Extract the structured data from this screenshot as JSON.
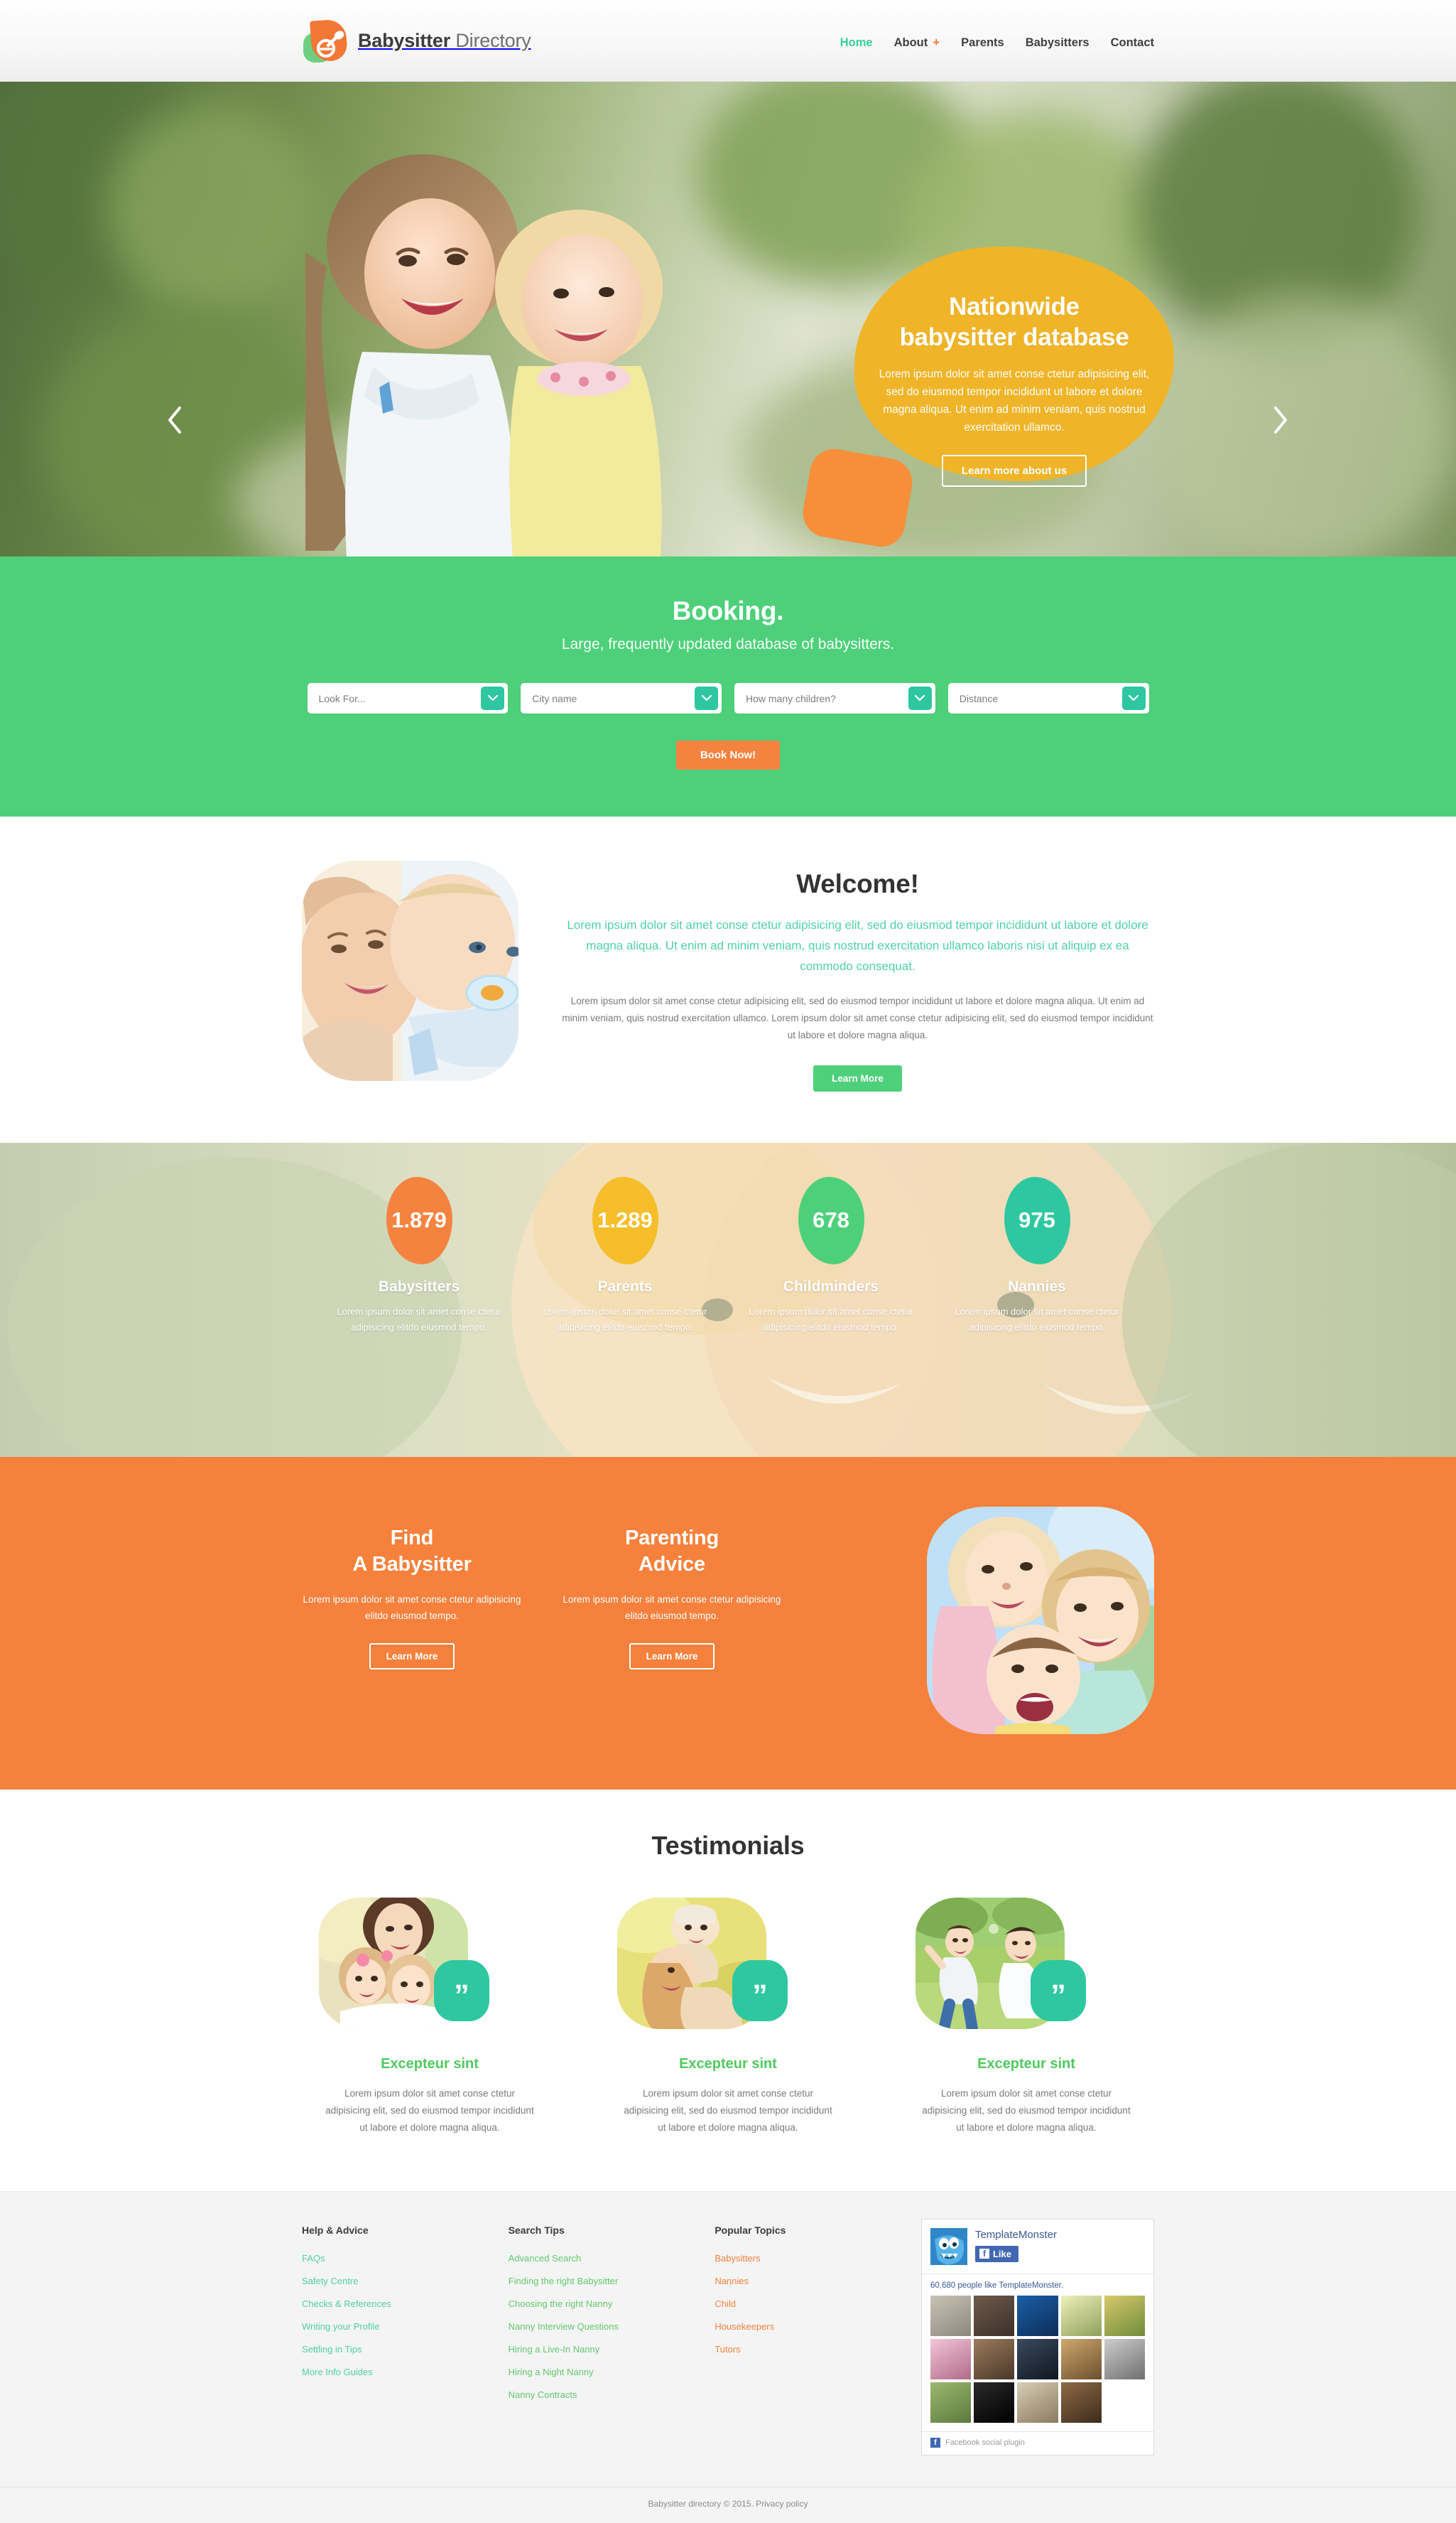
{
  "header": {
    "brand_bold": "Babysitter",
    "brand_light": " Directory",
    "logo_icon": "pacifier-logo-icon",
    "nav": [
      {
        "label": "Home",
        "active": true,
        "plus": ""
      },
      {
        "label": "About",
        "active": false,
        "plus": "+"
      },
      {
        "label": "Parents",
        "active": false,
        "plus": ""
      },
      {
        "label": "Babysitters",
        "active": false,
        "plus": ""
      },
      {
        "label": "Contact",
        "active": false,
        "plus": ""
      }
    ]
  },
  "hero": {
    "title_line1": "Nationwide",
    "title_line2": "babysitter database",
    "description": "Lorem ipsum dolor sit amet conse ctetur adipisicing elit, sed do eiusmod tempor incididunt ut labore et dolore magna aliqua. Ut enim ad minim veniam, quis nostrud exercitation ullamco.",
    "button": "Learn more about us",
    "prev_icon": "chevron-left-icon",
    "next_icon": "chevron-right-icon",
    "blob_color": "#f0b429",
    "tail_color": "#f78f3a"
  },
  "booking": {
    "title": "Booking.",
    "subtitle": "Large, frequently updated database of babysitters.",
    "fields": [
      {
        "placeholder": "Look For..."
      },
      {
        "placeholder": "City name"
      },
      {
        "placeholder": "How many children?"
      },
      {
        "placeholder": "Distance"
      }
    ],
    "button": "Book Now!",
    "bg_color": "#4ed07a",
    "arrow_color": "#2ec7a0",
    "button_color": "#f58340"
  },
  "welcome": {
    "heading": "Welcome!",
    "lead": "Lorem ipsum dolor sit amet conse ctetur adipisicing elit, sed do eiusmod tempor incididunt ut labore et dolore magna aliqua. Ut enim ad minim veniam, quis nostrud exercitation ullamco laboris nisi ut aliquip ex ea commodo consequat.",
    "body": "Lorem ipsum dolor sit amet conse ctetur adipisicing elit, sed do eiusmod tempor incididunt ut labore et dolore magna aliqua. Ut enim ad minim veniam, quis nostrud exercitation ullamco. Lorem ipsum dolor sit amet conse ctetur adipisicing elit, sed do eiusmod tempor incididunt ut labore et dolore magna aliqua.",
    "button": "Learn More",
    "image_alt": "mother-holding-baby-photo"
  },
  "stats": [
    {
      "value": "1.879",
      "name": "Babysitters",
      "desc": "Lorem ipsum dolor sit amet conse ctetur adipisicing elitdo eiusmod tempo.",
      "color": "#f58340"
    },
    {
      "value": "1.289",
      "name": "Parents",
      "desc": "Lorem ipsum dolor sit amet conse ctetur adipisicing elitdo eiusmod tempo.",
      "color": "#f5be2a"
    },
    {
      "value": "678",
      "name": "Childminders",
      "desc": "Lorem ipsum dolor sit amet conse ctetur adipisicing elitdo eiusmod tempo.",
      "color": "#4ed07a"
    },
    {
      "value": "975",
      "name": "Nannies",
      "desc": "Lorem ipsum dolor sit amet conse ctetur adipisicing elitdo eiusmod tempo.",
      "color": "#2ec7a0"
    }
  ],
  "promo": {
    "bg_color": "#f5813c",
    "columns": [
      {
        "title_line1": "Find",
        "title_line2": "A Babysitter",
        "desc": "Lorem ipsum dolor sit amet conse ctetur adipisicing elitdo eiusmod tempo.",
        "button": "Learn More"
      },
      {
        "title_line1": "Parenting",
        "title_line2": "Advice",
        "desc": "Lorem ipsum dolor sit amet conse ctetur adipisicing elitdo eiusmod tempo.",
        "button": "Learn More"
      }
    ],
    "image_alt": "three-happy-children-photo"
  },
  "testimonials": {
    "heading": "Testimonials",
    "quote_icon": "quote-mark-icon",
    "items": [
      {
        "name": "Excepteur sint",
        "text": "Lorem ipsum dolor sit amet conse ctetur adipisicing elit, sed do eiusmod tempor incididunt ut labore et dolore magna aliqua.",
        "quote": "”"
      },
      {
        "name": "Excepteur sint",
        "text": "Lorem ipsum dolor sit amet conse ctetur adipisicing elit, sed do eiusmod tempor incididunt ut labore et dolore magna aliqua.",
        "quote": "”"
      },
      {
        "name": "Excepteur sint",
        "text": "Lorem ipsum dolor sit amet conse ctetur adipisicing elit, sed do eiusmod tempor incididunt ut labore et dolore magna aliqua.",
        "quote": "”"
      }
    ]
  },
  "footer": {
    "columns": [
      {
        "heading": "Help & Advice",
        "color_class": "teal",
        "links": [
          "FAQs",
          "Safety Centre",
          "Checks & References",
          "Writing your Profile",
          "Settling in Tips",
          "More Info Guides"
        ]
      },
      {
        "heading": "Search Tips",
        "color_class": "green",
        "links": [
          "Advanced Search",
          "Finding the right Babysitter",
          "Choosing the right Nanny",
          "Nanny Interview Questions",
          "Hiring a Live-In Nanny",
          "Hiring a Night Nanny",
          "Nanny Contracts"
        ]
      },
      {
        "heading": "Popular Topics",
        "color_class": "orange",
        "links": [
          "Babysitters",
          "Nannies",
          "Child",
          "Housekeepers",
          "Tutors"
        ]
      }
    ],
    "facebook": {
      "page_name": "TemplateMonster",
      "like_label": "Like",
      "like_icon": "facebook-f-icon",
      "count_text_before": "60,680 people like ",
      "count_link": "TemplateMonster",
      "count_text_after": ".",
      "plugin_label": "Facebook social plugin"
    },
    "copyright": "Babysitter directory © 2015. Privacy policy"
  }
}
